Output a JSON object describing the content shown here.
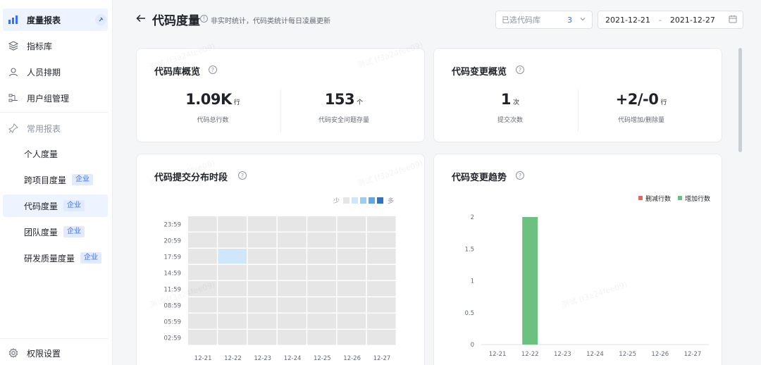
{
  "sidebar": {
    "items": [
      {
        "label": "度量报表",
        "icon": "bar-chart-icon",
        "active": true
      },
      {
        "label": "指标库",
        "icon": "layers-icon"
      },
      {
        "label": "人员排期",
        "icon": "user-icon"
      },
      {
        "label": "用户组管理",
        "icon": "group-icon"
      }
    ],
    "section_label": "常用报表",
    "sub_items": [
      {
        "label": "个人度量",
        "badge": ""
      },
      {
        "label": "跨项目度量",
        "badge": "企业"
      },
      {
        "label": "代码度量",
        "badge": "企业",
        "active": true
      },
      {
        "label": "团队度量",
        "badge": "企业"
      },
      {
        "label": "研发质量度量",
        "badge": "企业"
      }
    ],
    "footer_label": "权限设置"
  },
  "header": {
    "title": "代码度量",
    "note": "非实时统计，代码类统计每日凌晨更新",
    "repo_placeholder": "已选代码库",
    "repo_count": "3",
    "date_start": "2021-12-21",
    "date_sep": "-",
    "date_end": "2021-12-27"
  },
  "overview_repo": {
    "title": "代码库概览",
    "metrics": [
      {
        "value": "1.09K",
        "unit": "行",
        "label": "代码总行数"
      },
      {
        "value": "153",
        "unit": "个",
        "label": "代码安全问题存量"
      }
    ]
  },
  "overview_change": {
    "title": "代码变更概览",
    "metrics": [
      {
        "value": "1",
        "unit": "次",
        "label": "提交次数"
      },
      {
        "value": "+2/-0",
        "unit": "行",
        "label": "代码增加/删除量"
      }
    ]
  },
  "heatmap_card": {
    "title": "代码提交分布时段",
    "legend_low": "少",
    "legend_high": "多"
  },
  "trend_card": {
    "title": "代码变更趋势"
  },
  "watermark_text": "测试 (f3a24fee09)",
  "colors": {
    "accent": "#3370ff",
    "add": "#6cc080",
    "del": "#e06a5f",
    "heat_empty": "#e6e6e6",
    "heat_low": "#cfe7fb"
  },
  "chart_data": [
    {
      "type": "heatmap",
      "title": "代码提交分布时段",
      "x": [
        "12-21",
        "12-22",
        "12-23",
        "12-24",
        "12-25",
        "12-26",
        "12-27"
      ],
      "y": [
        "23:59",
        "20:59",
        "17:59",
        "14:59",
        "11:59",
        "08:59",
        "05:59",
        "02:59"
      ],
      "cells": [
        {
          "x": "12-22",
          "y": "17:59",
          "value": 1
        }
      ],
      "legend": {
        "low": "少",
        "high": "多"
      }
    },
    {
      "type": "bar",
      "title": "代码变更趋势",
      "categories": [
        "12-21",
        "12-22",
        "12-23",
        "12-24",
        "12-25",
        "12-26",
        "12-27"
      ],
      "series": [
        {
          "name": "删减行数",
          "color": "#e06a5f",
          "values": [
            0,
            0,
            0,
            0,
            0,
            0,
            0
          ]
        },
        {
          "name": "增加行数",
          "color": "#6cc080",
          "values": [
            0,
            2,
            0,
            0,
            0,
            0,
            0
          ]
        }
      ],
      "yticks": [
        "0",
        "0.5",
        "1",
        "1.5",
        "2"
      ],
      "ylim": [
        0,
        2
      ],
      "legend": "top-right"
    }
  ]
}
